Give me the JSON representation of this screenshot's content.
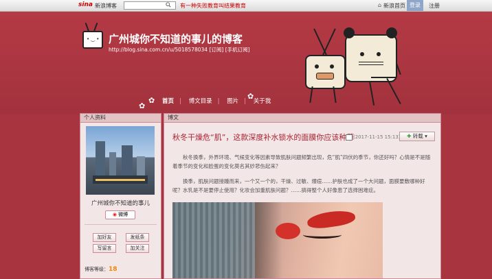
{
  "topbar": {
    "logo": "sina",
    "logo_text": "新浪博客",
    "search_value": "",
    "ad": "有一种失败教育叫结果教育",
    "visit": "新浪首页",
    "login": "登录",
    "register": "注册"
  },
  "header": {
    "title": "广州城你不知道的事儿的博客",
    "url": "http://blog.sina.com.cn/u/5018578034  [订阅] [手机订阅]"
  },
  "nav": [
    "首页",
    "博文目录",
    "图片",
    "关于我"
  ],
  "sidebar": {
    "header": "个人资料",
    "name": "广州城你不知道的事儿",
    "weibo": "微博",
    "buttons": [
      "加好友",
      "发纸条",
      "写留言",
      "加关注"
    ],
    "level_label": "博客等级：",
    "level_value": "18"
  },
  "main": {
    "header": "博文",
    "title": "秋冬干燥危“肌”，这款深度补水锁水的面膜你应该种草",
    "date": "(2017-11-15 15:13)",
    "repost": "转载",
    "para1": "秋冬换季，外界环境、气候变化等因素导致肌肤问题频繁出现，危“肌”四伏的季节，你还好吗？心情是不是随着季节的变化和脸蛋的变化莫名其妙悲伤起来？",
    "para2": "换季，肌肤问题接踵而来，一个又一个的，干燥、过敏、爆痘……护肤也成了一个大问题，面膜要敷哪种好呢？水乳是不是要停止使用？化妆会加重肌肤问题？……搞得整个人好像患了选择困难症。"
  }
}
